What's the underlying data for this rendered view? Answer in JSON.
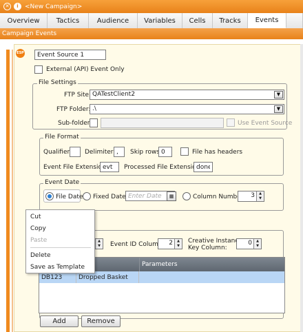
{
  "window": {
    "title": "<New Campaign>"
  },
  "tabs": [
    "Overview",
    "Tactics",
    "Audience",
    "Variables",
    "Cells",
    "Tracks",
    "Events"
  ],
  "section_title": "Campaign Events",
  "event_source": {
    "badge": "ESP",
    "name": "Event Source 1",
    "external_label": "External (API) Event Only"
  },
  "file_settings": {
    "legend": "File Settings",
    "ftp_site_label": "FTP Site:",
    "ftp_site_value": "QATestClient2",
    "ftp_folder_label": "FTP Folder:",
    "ftp_folder_value": ".\\",
    "subfolder_label": "Sub-folder:",
    "use_event_source_label": "Use Event Source"
  },
  "file_format": {
    "legend": "File Format",
    "qualifier_label": "Qualifier:",
    "qualifier_value": "",
    "delimiter_label": "Delimiter:",
    "delimiter_value": ",",
    "skip_rows_label": "Skip rows:",
    "skip_rows_value": "0",
    "headers_label": "File has headers",
    "ext_label": "Event File Extension:",
    "ext_value": "evt",
    "processed_label": "Processed File Extension:",
    "processed_value": "done"
  },
  "event_date": {
    "legend": "Event Date",
    "file_date_label": "File Date",
    "fixed_date_label": "Fixed Date:",
    "date_placeholder": "Enter Date",
    "column_number_label": "Column Number:",
    "column_number_value": "3"
  },
  "columns": {
    "event_id_label": "Event ID Column:",
    "event_id_value": "2",
    "creative_label_1": "Creative Instance",
    "creative_label_2": "Key Column:",
    "creative_value": "0"
  },
  "grid": {
    "headers": [
      "",
      "",
      "Parameters"
    ],
    "rows": [
      {
        "code": "DB123",
        "name": "Dropped Basket",
        "params": ""
      }
    ]
  },
  "buttons": {
    "add": "Add",
    "remove": "Remove"
  },
  "context_menu": {
    "items": [
      {
        "label": "Cut",
        "enabled": true
      },
      {
        "label": "Copy",
        "enabled": true
      },
      {
        "label": "Paste",
        "enabled": false
      },
      {
        "label": "Delete",
        "enabled": true
      },
      {
        "label": "Save as Template",
        "enabled": true
      }
    ]
  },
  "colors": {
    "accent": "#e8821a",
    "selection": "#b9d6f5",
    "grid_header": "#6b737c"
  }
}
